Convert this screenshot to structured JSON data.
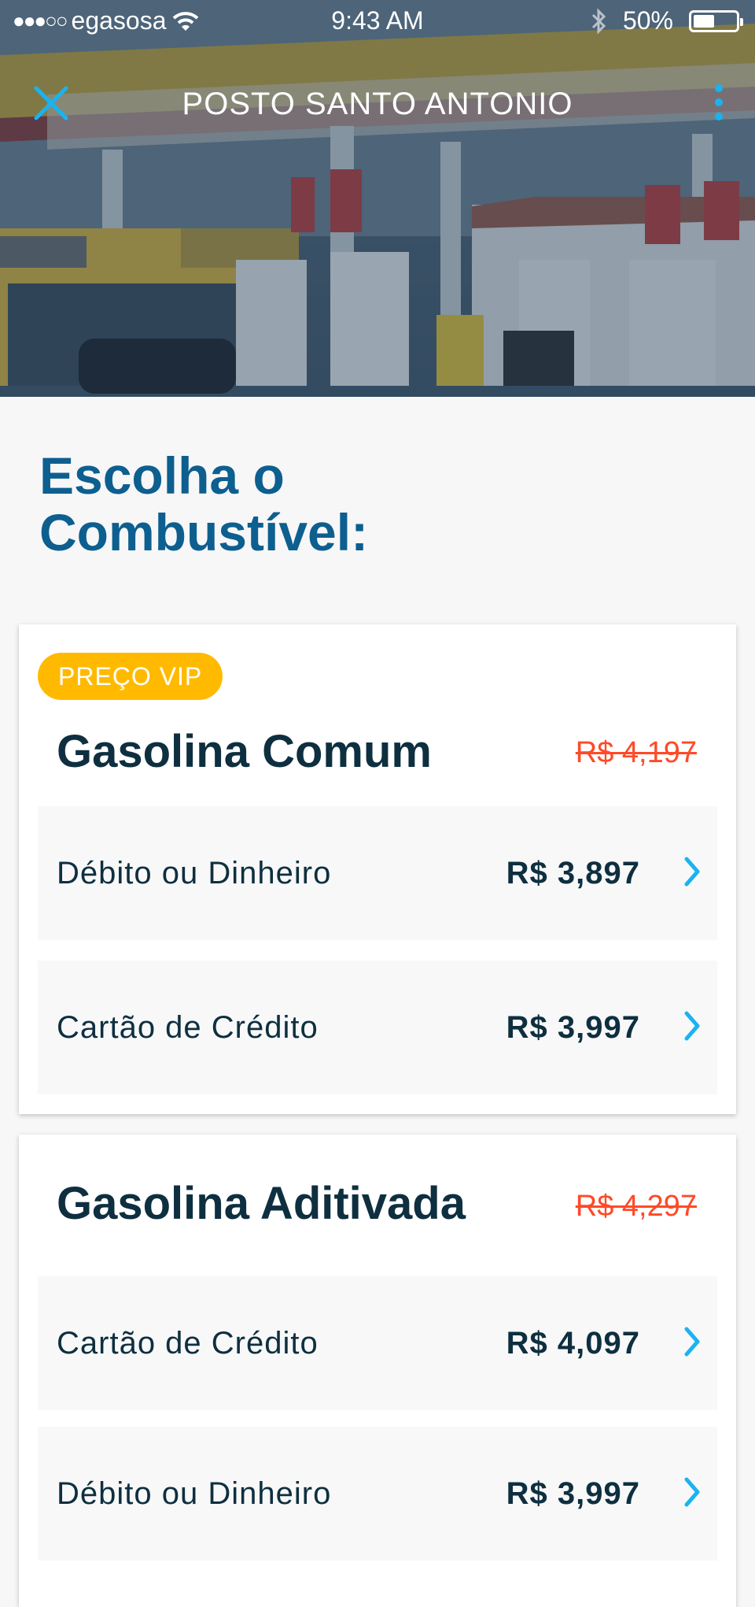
{
  "status_bar": {
    "signal_dots": "●●●○○",
    "carrier": "egasosa",
    "time": "9:43 AM",
    "battery_percent": "50%",
    "battery_level": 0.5,
    "icons": [
      "wifi-icon",
      "bluetooth-icon",
      "battery-icon"
    ]
  },
  "header": {
    "title": "POSTO SANTO ANTONIO",
    "close_icon": "close-icon",
    "more_icon": "more-vertical-icon"
  },
  "page": {
    "title_line1": "Escolha o",
    "title_line2": "Combustível:"
  },
  "fuels": [
    {
      "badge": "PREÇO VIP",
      "name": "Gasolina Comum",
      "old_price": "R$ 4,197",
      "options": [
        {
          "label": "Débito ou Dinheiro",
          "price": "R$ 3,897"
        },
        {
          "label": "Cartão de Crédito",
          "price": "R$ 3,997"
        }
      ]
    },
    {
      "name": "Gasolina Aditivada",
      "old_price": "R$ 4,297",
      "options": [
        {
          "label": "Cartão de Crédito",
          "price": "R$ 4,097"
        },
        {
          "label": "Débito ou Dinheiro",
          "price": "R$ 3,997"
        }
      ]
    }
  ],
  "colors": {
    "title_blue": "#0d5f8f",
    "accent_blue": "#1ab3f0",
    "vip_yellow": "#ffba00",
    "old_price_red": "#ff4a27",
    "text_dark": "#0e2f3f"
  }
}
